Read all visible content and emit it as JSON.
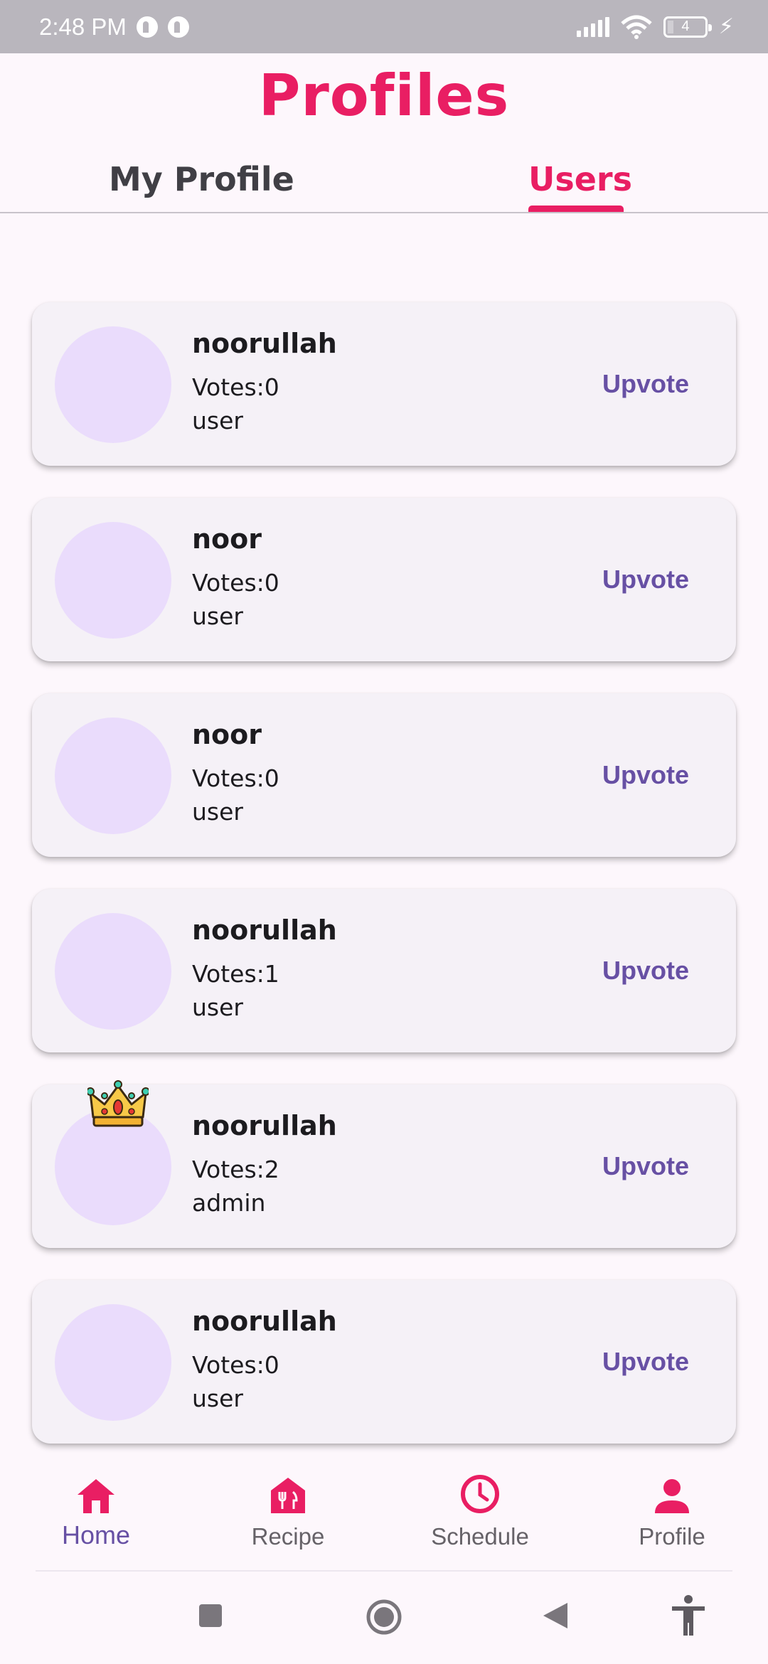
{
  "status_bar": {
    "time": "2:48 PM",
    "battery_level": "4",
    "icons": [
      "notification-icon",
      "notification-icon",
      "signal-icon",
      "wifi-icon",
      "battery-icon",
      "charging-bolt-icon"
    ]
  },
  "header": {
    "title": "Profiles"
  },
  "tabs": [
    {
      "label": "My Profile",
      "active": false
    },
    {
      "label": "Users",
      "active": true
    }
  ],
  "users": [
    {
      "name": "noorullah",
      "votes_text": "Votes:0",
      "role": "user",
      "upvote_label": "Upvote",
      "crown": false
    },
    {
      "name": "noor",
      "votes_text": "Votes:0",
      "role": "user",
      "upvote_label": "Upvote",
      "crown": false
    },
    {
      "name": "noor",
      "votes_text": "Votes:0",
      "role": "user",
      "upvote_label": "Upvote",
      "crown": false
    },
    {
      "name": "noorullah",
      "votes_text": "Votes:1",
      "role": "user",
      "upvote_label": "Upvote",
      "crown": false
    },
    {
      "name": "noorullah",
      "votes_text": "Votes:2",
      "role": "admin",
      "upvote_label": "Upvote",
      "crown": true
    },
    {
      "name": "noorullah",
      "votes_text": "Votes:0",
      "role": "user",
      "upvote_label": "Upvote",
      "crown": false
    }
  ],
  "bottom_nav": [
    {
      "label": "Home",
      "icon": "home-icon",
      "active": true
    },
    {
      "label": "Recipe",
      "icon": "restaurant-icon",
      "active": false
    },
    {
      "label": "Schedule",
      "icon": "clock-icon",
      "active": false
    },
    {
      "label": "Profile",
      "icon": "person-icon",
      "active": false
    }
  ],
  "system_nav": {
    "icons": [
      "recents-square-icon",
      "home-circle-icon",
      "back-triangle-icon",
      "accessibility-icon"
    ]
  },
  "colors": {
    "accent": "#e91e63",
    "button_text": "#6750a4",
    "card_bg": "#f5f1f7",
    "avatar_bg": "#eadcfc",
    "page_bg": "#fdf7fc",
    "status_bar_bg": "#b9b6bd"
  }
}
